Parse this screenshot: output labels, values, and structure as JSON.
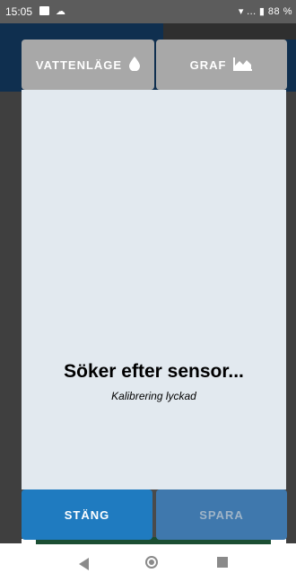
{
  "status_bar": {
    "time": "15:05",
    "right_text": "▾ … ▮ 88 %"
  },
  "top_buttons": {
    "water_mode_label": "VATTENLÄGE",
    "water_mode_icon": "water-drop-icon",
    "graph_label": "GRAF",
    "graph_icon": "area-chart-icon"
  },
  "panel": {
    "title": "Söker efter sensor...",
    "subtitle": "Kalibrering lyckad"
  },
  "bottom_buttons": {
    "close_label": "STÄNG",
    "save_label": "SPARA"
  },
  "colors": {
    "accent": "#1f7bc0",
    "disabled_button": "#3f78ad",
    "panel_bg": "#e2e9ef",
    "top_button_bg": "#a8a8a8"
  }
}
